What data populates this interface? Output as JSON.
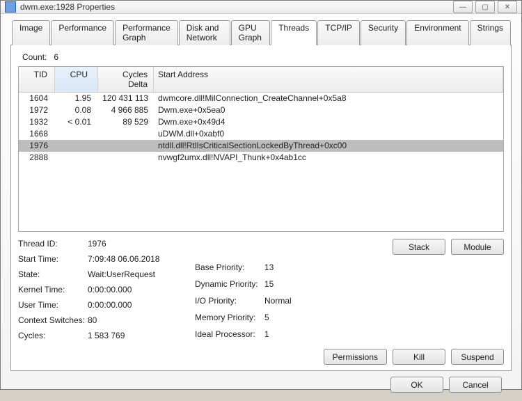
{
  "window": {
    "title": "dwm.exe:1928 Properties"
  },
  "tabs": [
    "Image",
    "Performance",
    "Performance Graph",
    "Disk and Network",
    "GPU Graph",
    "Threads",
    "TCP/IP",
    "Security",
    "Environment",
    "Strings"
  ],
  "active_tab": 5,
  "count_label": "Count:",
  "count_value": "6",
  "columns": {
    "tid": "TID",
    "cpu": "CPU",
    "cycles": "Cycles Delta",
    "addr": "Start Address"
  },
  "threads": [
    {
      "tid": "1604",
      "cpu": "1.95",
      "cycles": "120 431 113",
      "addr": "dwmcore.dll!MilConnection_CreateChannel+0x5a8",
      "sel": false
    },
    {
      "tid": "1972",
      "cpu": "0.08",
      "cycles": "4 966 885",
      "addr": "Dwm.exe+0x5ea0",
      "sel": false
    },
    {
      "tid": "1932",
      "cpu": "< 0.01",
      "cycles": "89 529",
      "addr": "Dwm.exe+0x49d4",
      "sel": false
    },
    {
      "tid": "1668",
      "cpu": "",
      "cycles": "",
      "addr": "uDWM.dll+0xabf0",
      "sel": false
    },
    {
      "tid": "1976",
      "cpu": "",
      "cycles": "",
      "addr": "ntdll.dll!RtlIsCriticalSectionLockedByThread+0xc00",
      "sel": true
    },
    {
      "tid": "2888",
      "cpu": "",
      "cycles": "",
      "addr": "nvwgf2umx.dll!NVAPI_Thunk+0x4ab1cc",
      "sel": false
    }
  ],
  "details": {
    "left": {
      "thread_id_l": "Thread ID:",
      "thread_id_v": "1976",
      "start_time_l": "Start Time:",
      "start_time_v": "7:09:48   06.06.2018",
      "state_l": "State:",
      "state_v": "Wait:UserRequest",
      "kernel_time_l": "Kernel Time:",
      "kernel_time_v": "0:00:00.000",
      "user_time_l": "User Time:",
      "user_time_v": "0:00:00.000",
      "ctx_sw_l": "Context Switches:",
      "ctx_sw_v": "80",
      "cycles_l": "Cycles:",
      "cycles_v": "1 583 769"
    },
    "right": {
      "base_pri_l": "Base Priority:",
      "base_pri_v": "13",
      "dyn_pri_l": "Dynamic Priority:",
      "dyn_pri_v": "15",
      "io_pri_l": "I/O Priority:",
      "io_pri_v": "Normal",
      "mem_pri_l": "Memory Priority:",
      "mem_pri_v": "5",
      "ideal_l": "Ideal Processor:",
      "ideal_v": "1"
    }
  },
  "buttons": {
    "stack": "Stack",
    "module": "Module",
    "permissions": "Permissions",
    "kill": "Kill",
    "suspend": "Suspend",
    "ok": "OK",
    "cancel": "Cancel"
  }
}
